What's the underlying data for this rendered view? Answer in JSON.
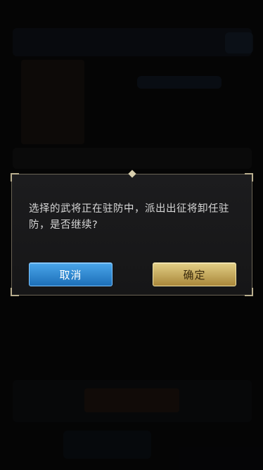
{
  "dialog": {
    "message": "选择的武将正在驻防中，派出出征将卸任驻防，是否继续?",
    "cancel_label": "取消",
    "confirm_label": "确定"
  },
  "colors": {
    "cancel_button": "#2f8ed6",
    "confirm_button": "#c9ad5e",
    "dialog_bg": "#1b1b1c",
    "dialog_border": "#6b6455"
  }
}
